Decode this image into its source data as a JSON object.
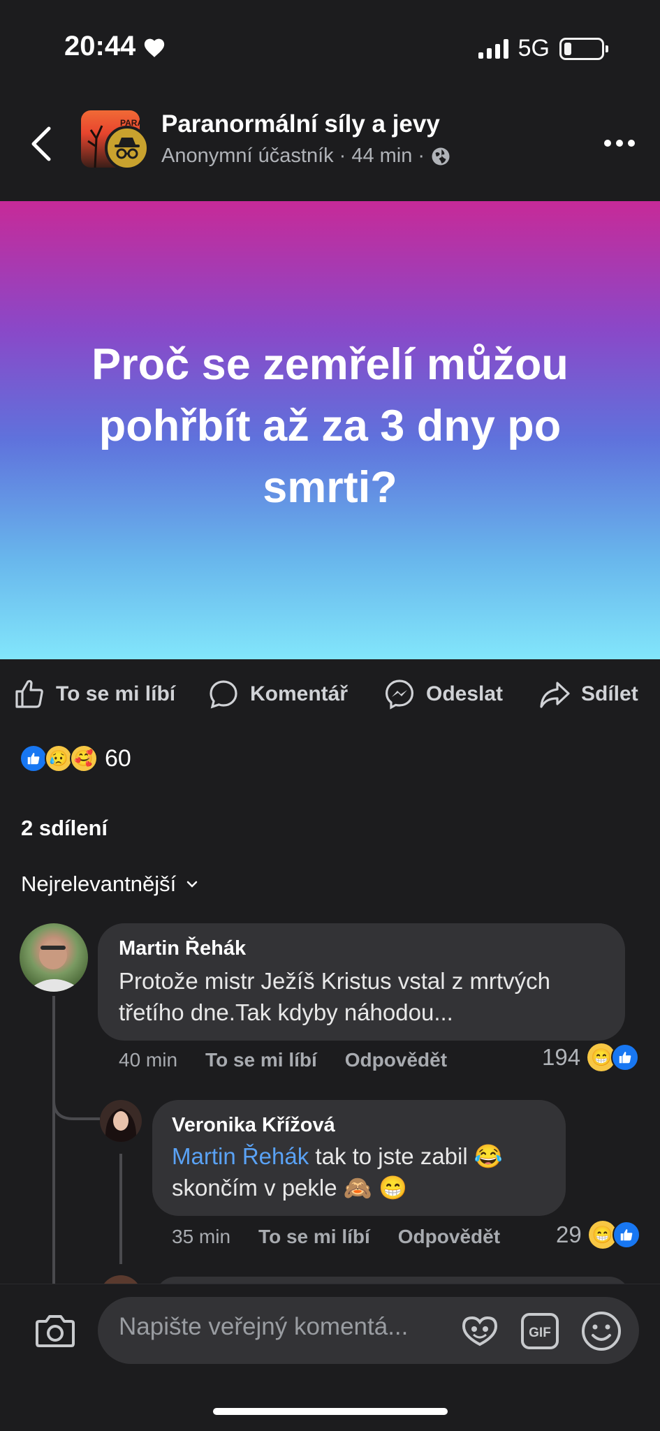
{
  "status_bar": {
    "time": "20:44",
    "network": "5G"
  },
  "header": {
    "group_name": "Paranormální síly a jevy",
    "author": "Anonymní účastník",
    "separator": "·",
    "time_ago": "44 min",
    "group_image_text": "PARA"
  },
  "post": {
    "text": "Proč se zemřelí můžou pohřbít až za 3 dny po smrti?"
  },
  "actions": {
    "like": "To se mi líbí",
    "comment": "Komentář",
    "send": "Odeslat",
    "share": "Sdílet"
  },
  "reactions": {
    "count": "60"
  },
  "shares": "2 sdílení",
  "sort_label": "Nejrelevantnější",
  "comments": [
    {
      "name": "Martin Řehák",
      "text_line1": "Protože mistr Ježíš Kristus vstal z mrtvých",
      "text_line2": "třetího dne.Tak kdyby náhodou...",
      "time": "40 min",
      "like": "To se mi líbí",
      "reply": "Odpovědět",
      "reaction_count": "194"
    },
    {
      "name": "Veronika Křížová",
      "mention": "Martin Řehák",
      "text_line1": " tak to jste zabil 😂",
      "text_line2": "skončím v pekle 🙈 😁",
      "time": "35 min",
      "like": "To se mi líbí",
      "reply": "Odpovědět",
      "reaction_count": "29"
    }
  ],
  "composer": {
    "placeholder": "Napište veřejný komentá..."
  },
  "colors": {
    "accent": "#1877f2",
    "mention": "#5aa2f5",
    "background": "#1c1c1e",
    "bubble": "#333336"
  }
}
